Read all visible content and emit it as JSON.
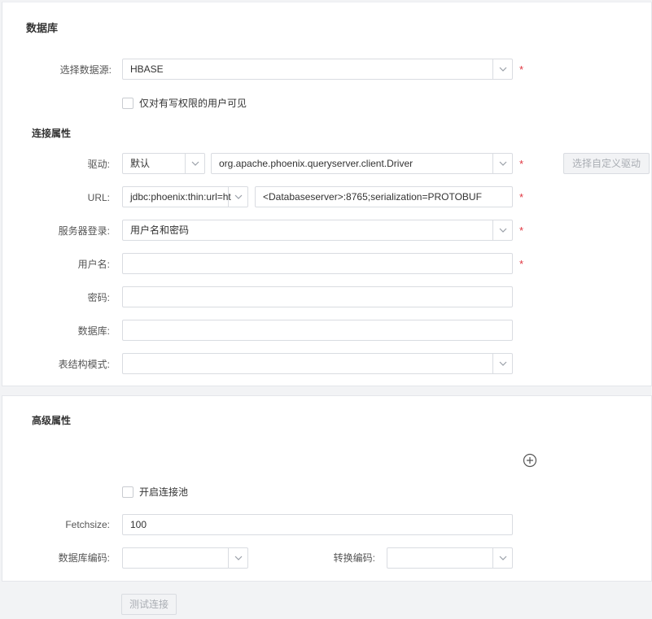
{
  "database_section": {
    "title": "数据库",
    "datasource_label": "选择数据源:",
    "datasource_value": "HBASE",
    "visibility_checkbox_label": "仅对有写权限的用户可见"
  },
  "connection": {
    "title": "连接属性",
    "driver_label": "驱动:",
    "driver_type_value": "默认",
    "driver_class_value": "org.apache.phoenix.queryserver.client.Driver",
    "custom_driver_button": "选择自定义驱动",
    "url_label": "URL:",
    "url_prefix_value": "jdbc:phoenix:thin:url=ht",
    "url_value": "<Databaseserver>:8765;serialization=PROTOBUF",
    "login_label": "服务器登录:",
    "login_value": "用户名和密码",
    "username_label": "用户名:",
    "username_value": "",
    "password_label": "密码:",
    "password_value": "",
    "database_label": "数据库:",
    "database_value": "",
    "schema_label": "表结构模式:",
    "schema_value": ""
  },
  "advanced": {
    "title": "高级属性",
    "pool_checkbox_label": "开启连接池",
    "fetchsize_label": "Fetchsize:",
    "fetchsize_value": "100",
    "db_encoding_label": "数据库编码:",
    "db_encoding_value": "",
    "convert_encoding_label": "转换编码:",
    "convert_encoding_value": ""
  },
  "footer": {
    "test_button": "测试连接"
  },
  "required_mark": "*",
  "icons": {
    "dropdown": "chevron-down-icon",
    "add": "plus-circle-icon"
  },
  "colors": {
    "required": "#e0353f",
    "border": "#d9dce1",
    "disabled_text": "#a9adb3"
  }
}
